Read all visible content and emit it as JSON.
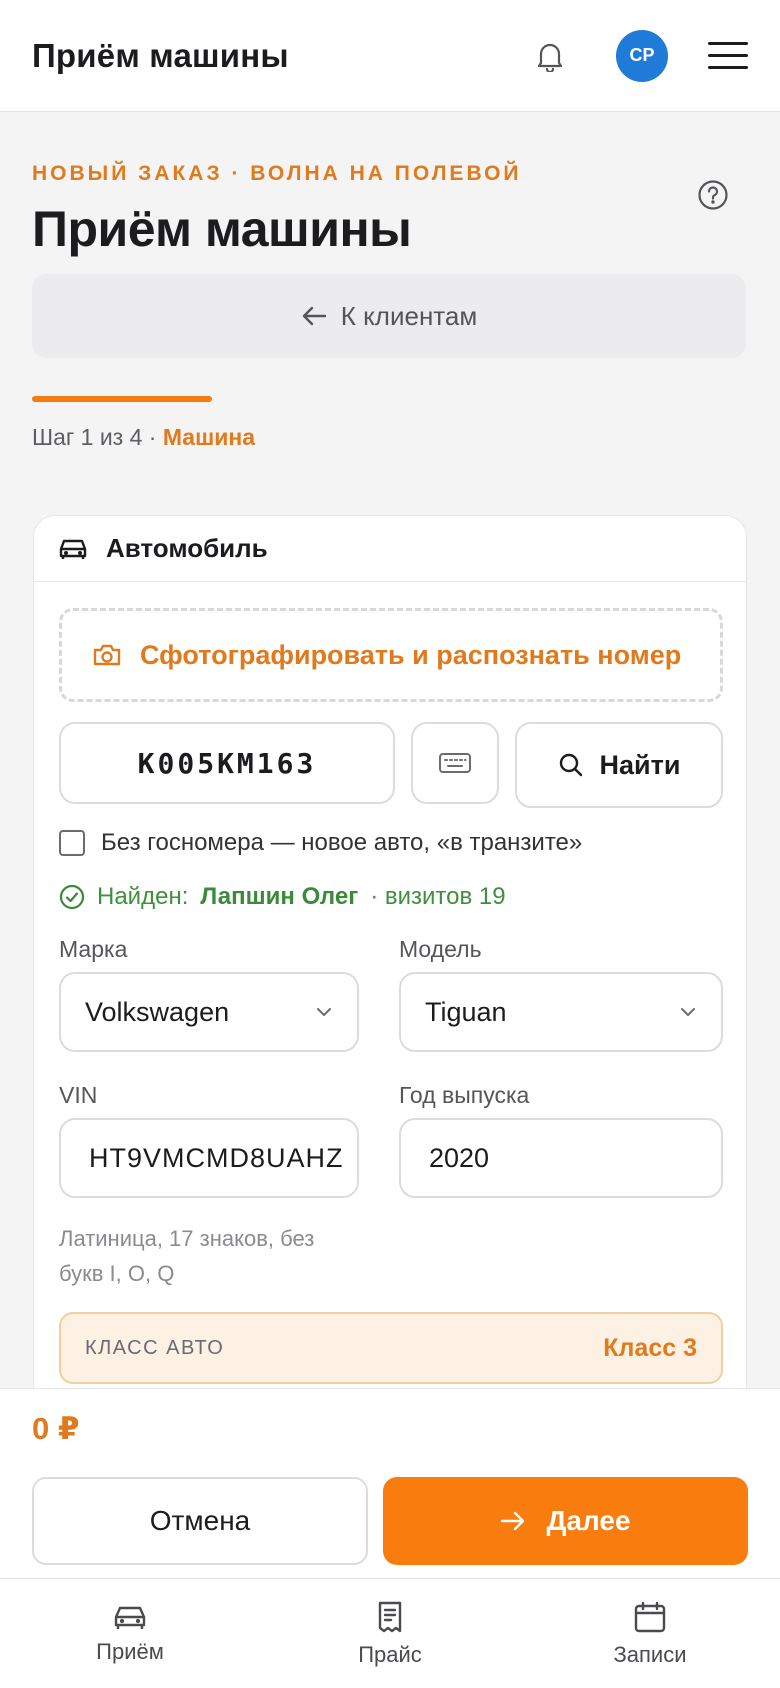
{
  "header": {
    "title": "Приём машины",
    "avatar_initials": "СР",
    "icons": [
      "bell-icon",
      "menu-icon"
    ]
  },
  "page": {
    "kicker": "НОВЫЙ ЗАКАЗ · ВОЛНА НА ПОЛЕВОЙ",
    "title": "Приём машины",
    "back_label": "К клиентам",
    "step_prefix": "Шаг 1 из 4 · ",
    "step_name": "Машина",
    "progress": 0.25
  },
  "card": {
    "title": "Автомобиль",
    "photo_label": "Сфотографировать и распознать номер",
    "plate_value": "К005КМ163",
    "find_label": "Найти",
    "no_plate_label": "Без госномера — новое авто, «в транзите»",
    "no_plate_checked": false,
    "found_label": "Найден:",
    "found_name": "Лапшин Олег",
    "found_visits": "· визитов 19",
    "make_label": "Марка",
    "make_value": "Volkswagen",
    "model_label": "Модель",
    "model_value": "Tiguan",
    "vin_label": "VIN",
    "vin_value": "HT9VMCMD8UAHZ",
    "year_label": "Год выпуска",
    "year_value": "2020",
    "vin_hint": "Латиница, 17 знаков, без букв I, O, Q",
    "class_label": "КЛАСС АВТО",
    "class_value": "Класс 3"
  },
  "footer": {
    "total": "0 ₽",
    "cancel_label": "Отмена",
    "next_label": "Далее"
  },
  "nav": [
    {
      "label": "Приём",
      "icon": "car-icon"
    },
    {
      "label": "Прайс",
      "icon": "receipt-icon"
    },
    {
      "label": "Записи",
      "icon": "calendar-icon"
    }
  ],
  "colors": {
    "accent": "#f97c0e",
    "success": "#3a8a3a",
    "avatar": "#1f7bd8"
  }
}
